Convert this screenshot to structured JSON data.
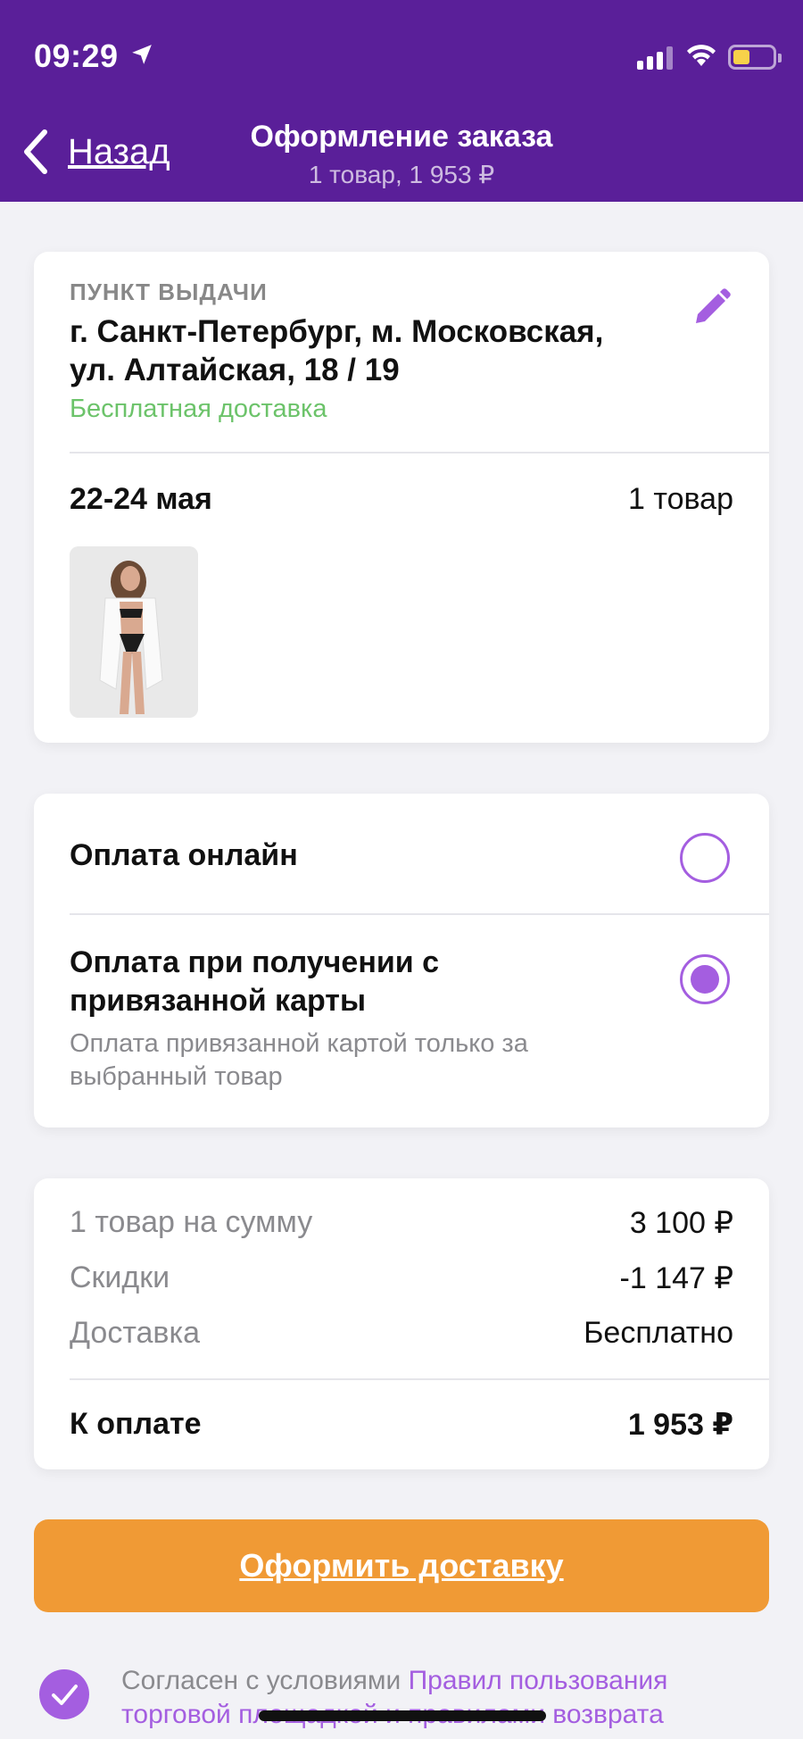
{
  "status": {
    "time": "09:29"
  },
  "header": {
    "back_label": "Назад",
    "title": "Оформление заказа",
    "subtitle": "1 товар, 1 953 ₽",
    "bg_color": "#5a1f99"
  },
  "delivery": {
    "section_label": "ПУНКТ ВЫДАЧИ",
    "address_line1": "г. Санкт-Петербург, м. Московская,",
    "address_line2": "ул. Алтайская, 18 / 19",
    "shipping_note": "Бесплатная доставка",
    "date_range": "22-24 мая",
    "item_count": "1 товар",
    "edit_icon": "pencil-icon"
  },
  "payment": {
    "online_label": "Оплата онлайн",
    "online_selected": false,
    "on_receipt_line1": "Оплата при получении с",
    "on_receipt_line2": "привязанной карты",
    "on_receipt_selected": true,
    "on_receipt_desc_line1": "Оплата привязанной картой только за",
    "on_receipt_desc_line2": "выбранный товар"
  },
  "summary": {
    "items_label": "1 товар на сумму",
    "items_value": "3 100 ₽",
    "discount_label": "Скидки",
    "discount_value": "-1 147 ₽",
    "shipping_label": "Доставка",
    "shipping_value": "Бесплатно",
    "total_label": "К оплате",
    "total_value": "1 953 ₽"
  },
  "cta": {
    "label": "Оформить доставку",
    "color": "#f09a35"
  },
  "agreement": {
    "prefix": "Согласен с условиями ",
    "link_line1": "Правил пользования",
    "link_line2": "торговой площадкой и правилами возврата",
    "checked": true
  },
  "colors": {
    "accent": "#a45ee0",
    "success": "#6cc36a"
  }
}
